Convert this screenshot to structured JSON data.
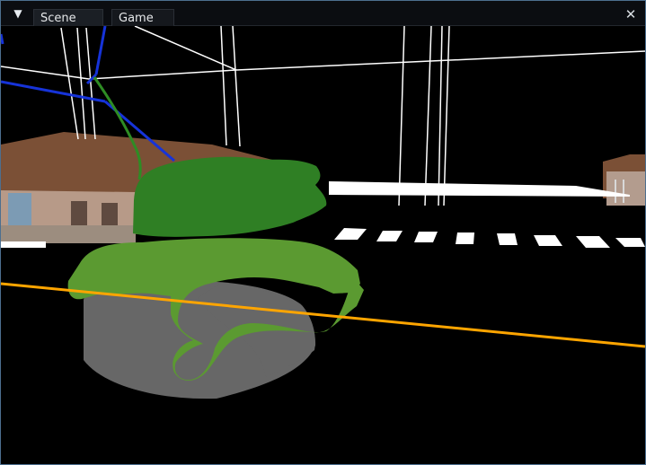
{
  "window": {
    "tabs": [
      {
        "label": "Scene"
      },
      {
        "label": "Game"
      }
    ],
    "menu_icon": "▼",
    "close_icon": "✕"
  },
  "scene": {
    "background": "#000000",
    "colors": {
      "tank_turret": "#2f7f24",
      "tank_body": "#5b9a31",
      "tank_tracks": "#676767",
      "building_roof": "#7a4d34",
      "building_wall": "#b59785",
      "road_marking": "#ffffff",
      "wire": "#ffffff",
      "axis_blue": "#1633d8",
      "axis_green": "#2e8c24",
      "orange_line": "#ffa500"
    }
  }
}
